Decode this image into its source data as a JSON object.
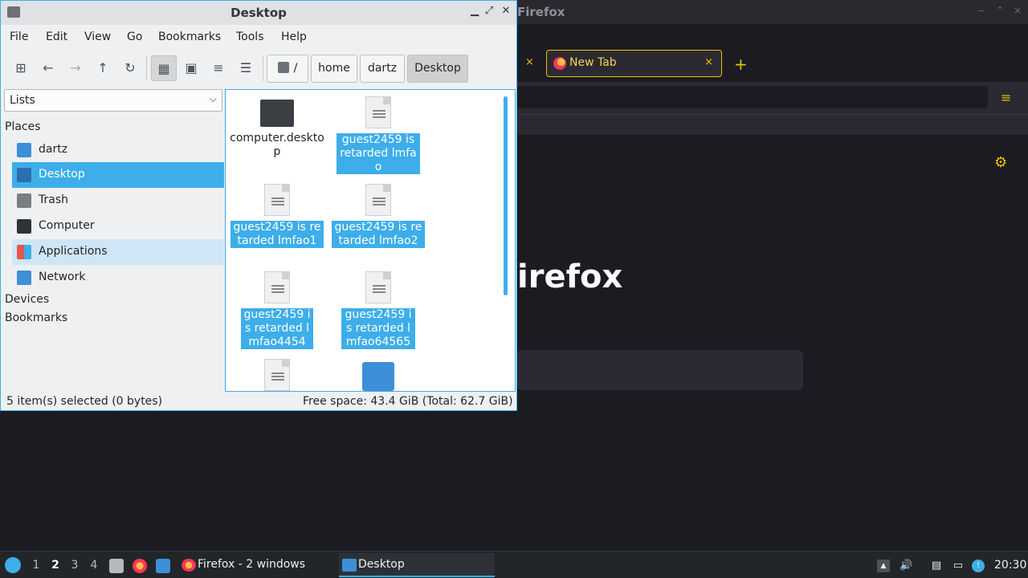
{
  "firefox": {
    "window_title": "Firefox",
    "tab_title": "New Tab",
    "tab_close": "×",
    "prev_tab_close": "×",
    "new_tab": "+",
    "menu_icon": "≡",
    "settings_icon": "⚙",
    "wordmark": "irefox",
    "win_min": "‒",
    "win_max": "⌃",
    "win_close": "×"
  },
  "file_manager": {
    "title": "Desktop",
    "window_buttons": {
      "minimize": "▁",
      "maximize": "⤢",
      "close": "✕"
    },
    "menu": [
      "File",
      "Edit",
      "View",
      "Go",
      "Bookmarks",
      "Tools",
      "Help"
    ],
    "toolbar": {
      "new_window": "⊞",
      "back": "←",
      "forward": "→",
      "up": "↑",
      "reload": "↻",
      "icon_view": "▦",
      "thumbnail_view": "▣",
      "compact_view": "≡",
      "detail_view": "☰"
    },
    "breadcrumb": [
      "/",
      "home",
      "dartz",
      "Desktop"
    ],
    "side_selector": "Lists",
    "side_selector_arrow": "⌵",
    "sections": {
      "places": "Places",
      "devices": "Devices",
      "bookmarks": "Bookmarks"
    },
    "places": [
      {
        "label": "dartz",
        "icon": "home-folder-icon",
        "color": "#3d8fd8"
      },
      {
        "label": "Desktop",
        "icon": "desktop-folder-icon",
        "color": "#2a6fb0"
      },
      {
        "label": "Trash",
        "icon": "trash-icon",
        "color": "#7a7e82"
      },
      {
        "label": "Computer",
        "icon": "computer-icon",
        "color": "#2f3337"
      },
      {
        "label": "Applications",
        "icon": "applications-icon",
        "color": "#e0584a"
      },
      {
        "label": "Network",
        "icon": "network-icon",
        "color": "#3d8fd8"
      }
    ],
    "files": [
      {
        "name": "computer.desktop",
        "icon": "computer-icon",
        "selected": false
      },
      {
        "name": "guest2459 is retarded lmfao",
        "icon": "text-file-icon",
        "selected": true
      },
      {
        "name": "guest2459 is retarded lmfao1",
        "icon": "text-file-icon",
        "selected": true
      },
      {
        "name": "guest2459 is retarded lmfao2",
        "icon": "text-file-icon",
        "selected": true
      },
      {
        "name": "guest2459 is retarded lmfao4454",
        "icon": "text-file-icon",
        "selected": true
      },
      {
        "name": "guest2459 is retarded lmfao64565",
        "icon": "text-file-icon",
        "selected": true
      },
      {
        "name": "",
        "icon": "text-file-icon",
        "selected": false
      },
      {
        "name": "",
        "icon": "network-folder-icon",
        "selected": false
      }
    ],
    "status_left": "5 item(s) selected (0 bytes)",
    "status_right": "Free space: 43.4 GiB (Total: 62.7 GiB)"
  },
  "taskbar": {
    "desktops": [
      "1",
      "2",
      "3",
      "4"
    ],
    "current_desktop": "2",
    "tasks": [
      {
        "label": "Firefox - 2 windows",
        "icon": "firefox-icon"
      },
      {
        "label": "Desktop",
        "icon": "folder-icon"
      }
    ],
    "tray": {
      "up_arrow": "▲",
      "volume": "🔊",
      "clipboard": "▤",
      "display": "▭",
      "notice": "!"
    },
    "clock": "20:30"
  },
  "colors": {
    "accent": "#3daee9",
    "firefox_accent": "#e6c200",
    "panel_bg": "#eff0f1",
    "taskbar_bg": "#232629"
  }
}
